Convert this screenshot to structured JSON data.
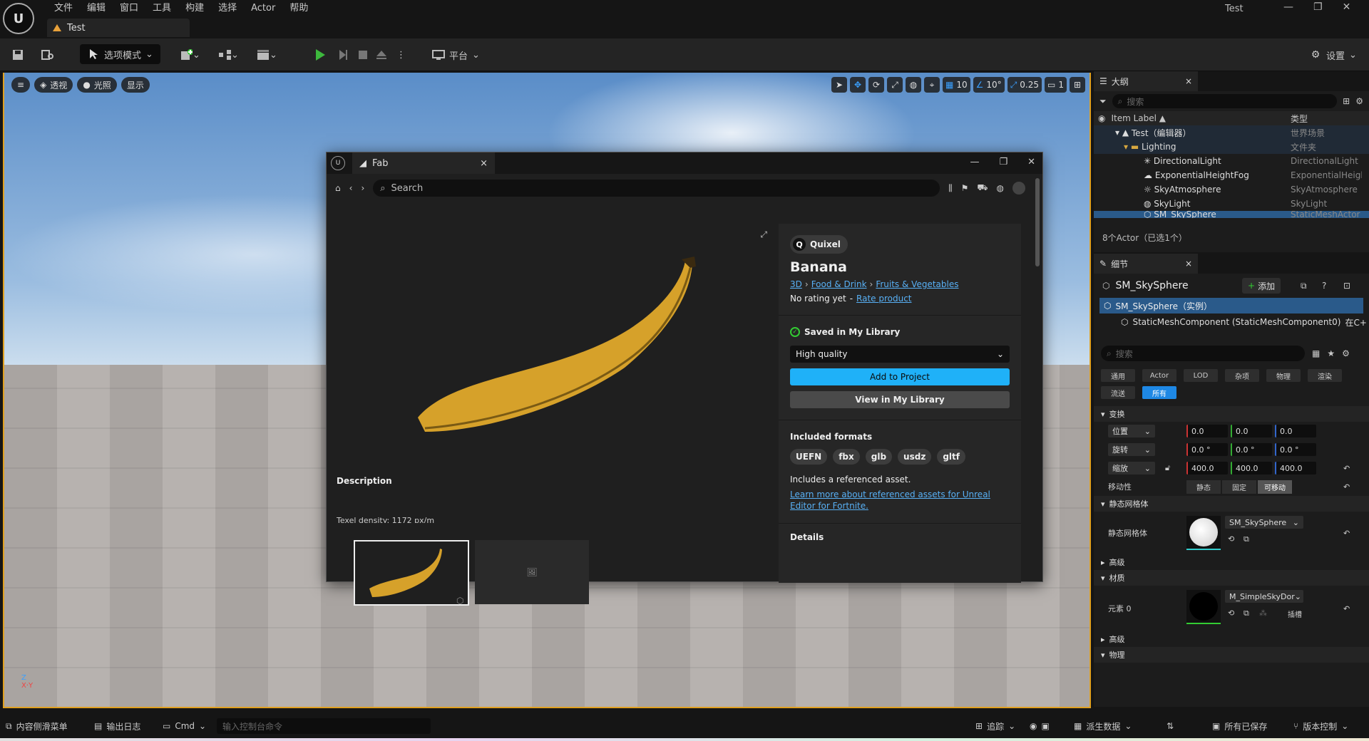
{
  "app": {
    "logo_text": "U",
    "menu": [
      "文件",
      "编辑",
      "窗口",
      "工具",
      "构建",
      "选择",
      "Actor",
      "帮助"
    ],
    "project_tab": "Test",
    "window_title": "Test",
    "win_min": "—",
    "win_max": "❐",
    "win_close": "✕"
  },
  "toolbar": {
    "mode_label": "选项模式",
    "platform_label": "平台",
    "settings_label": "设置"
  },
  "viewport": {
    "perspective": "透视",
    "lighting": "光照",
    "show": "显示",
    "grid_snap": "10",
    "rot_snap": "10°",
    "scale_snap": "0.25",
    "camera_speed": "1",
    "axis_z": "Z",
    "axis_xy": "X·Y"
  },
  "fab": {
    "tab_title": "Fab",
    "tab_close": "×",
    "search_placeholder": "Search",
    "badge": "Quixel",
    "asset_name": "Banana",
    "crumb_1": "3D",
    "crumb_2": "Food & Drink",
    "crumb_3": "Fruits & Vegetables",
    "rating": "No rating yet",
    "rating_sep": "-",
    "rate_link": "Rate product",
    "saved_label": "Saved in My Library",
    "quality": "High quality",
    "add_button": "Add to Project",
    "view_button": "View in My Library",
    "formats_title": "Included formats",
    "formats": [
      "UEFN",
      "fbx",
      "glb",
      "usdz",
      "gltf"
    ],
    "ref_text": "Includes a referenced asset.",
    "ref_link_1": "Learn more about referenced assets for Unreal",
    "ref_link_2": "Editor for Fortnite.",
    "details_title": "Details",
    "description_title": "Description",
    "description_text": "Texel density: 1172 px/m"
  },
  "outliner": {
    "tab": "大纲",
    "close": "×",
    "search_placeholder": "搜索",
    "col_label": "Item Label ▲",
    "col_type": "类型",
    "rows": [
      {
        "label": "Test（编辑器）",
        "type": "世界场景"
      },
      {
        "label": "Lighting",
        "type": "文件夹"
      },
      {
        "label": "DirectionalLight",
        "type": "DirectionalLight"
      },
      {
        "label": "ExponentialHeightFog",
        "type": "ExponentialHeightFog"
      },
      {
        "label": "SkyAtmosphere",
        "type": "SkyAtmosphere"
      },
      {
        "label": "SkyLight",
        "type": "SkyLight"
      },
      {
        "label": "SM_SkySphere",
        "type": "StaticMeshActor"
      }
    ],
    "footer": "8个Actor（已选1个）"
  },
  "details": {
    "tab": "细节",
    "close": "×",
    "object_name": "SM_SkySphere",
    "add_label": "添加",
    "instance_label": "SM_SkySphere（实例）",
    "component_label": "StaticMeshComponent (StaticMeshComponent0)",
    "component_suffix": "在C+",
    "search_placeholder": "搜索",
    "filter_tabs": [
      "通用",
      "Actor",
      "LOD",
      "杂项",
      "物理",
      "渲染",
      "流送",
      "所有"
    ],
    "transform_section": "变换",
    "location_label": "位置",
    "rotation_label": "旋转",
    "scale_label": "缩放",
    "location": [
      "0.0",
      "0.0",
      "0.0"
    ],
    "rotation": [
      "0.0 °",
      "0.0 °",
      "0.0 °"
    ],
    "scale": [
      "400.0",
      "400.0",
      "400.0"
    ],
    "mobility_label": "移动性",
    "mobility_options": [
      "静态",
      "固定",
      "可移动"
    ],
    "static_mesh_section": "静态网格体",
    "static_mesh_label": "静态网格体",
    "static_mesh_value": "SM_SkySphere",
    "advanced_1": "高级",
    "materials_section": "材质",
    "element_label": "元素 0",
    "material_value": "M_SimpleSkyDor",
    "slot_label": "插槽",
    "advanced_2": "高级",
    "physics_section": "物理"
  },
  "statusbar": {
    "content_drawer": "内容侧滑菜单",
    "output_log": "输出日志",
    "cmd": "Cmd",
    "cmd_placeholder": "输入控制台命令",
    "trace": "追踪",
    "derived_data": "派生数据",
    "all_saved": "所有已保存",
    "source_control": "版本控制"
  },
  "colors": {
    "accent_blue": "#1fb1f8",
    "selection_orange": "#e0a020",
    "link_blue": "#58b0f5",
    "active_filter": "#1e88e5"
  }
}
